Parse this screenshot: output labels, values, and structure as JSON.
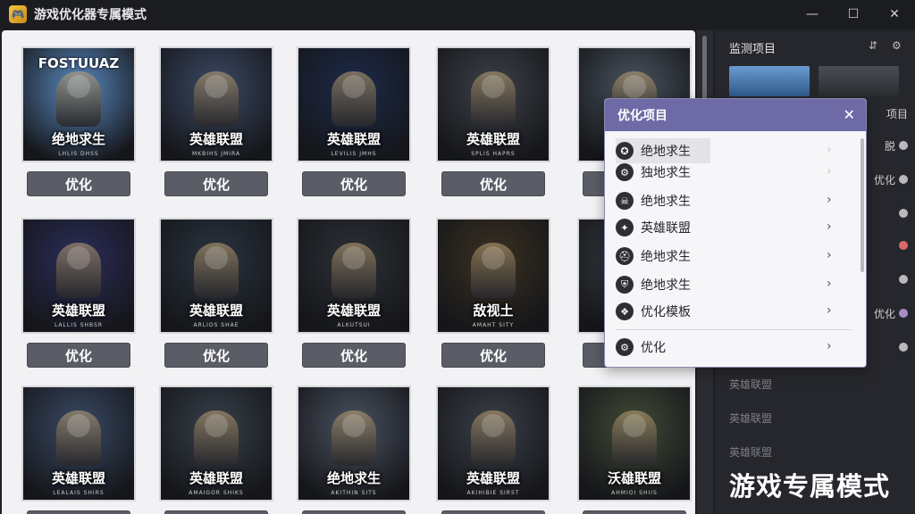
{
  "window": {
    "title": "游戏优化器专属模式",
    "app_icon": "game-controller-icon",
    "controls": {
      "minimize": "—",
      "maximize": "☐",
      "close": "✕"
    }
  },
  "grid": {
    "button_label": "优化",
    "rows": [
      [
        {
          "title": "绝地求生",
          "sub": "LHLIS DHSS",
          "brand": "FOSTUUAZ",
          "theme": "#5a8ac0"
        },
        {
          "title": "英雄联盟",
          "sub": "MKBIHS JMIRA",
          "theme": "#3b4a66"
        },
        {
          "title": "英雄联盟",
          "sub": "LEVILIS JMHS",
          "theme": "#1c2a4a"
        },
        {
          "title": "英雄联盟",
          "sub": "SPLIS HAPRS",
          "theme": "#3c4148"
        },
        {
          "title": "",
          "sub": "",
          "theme": "#4a5560"
        }
      ],
      [
        {
          "title": "英雄联盟",
          "sub": "LALLIS SHBSR",
          "theme": "#2b2d5a"
        },
        {
          "title": "英雄联盟",
          "sub": "ARLIOS SHAE",
          "theme": "#2a3440"
        },
        {
          "title": "英雄联盟",
          "sub": "ALKUTSUI",
          "theme": "#2c3036"
        },
        {
          "title": "敌视土",
          "sub": "AMAHT SITY",
          "theme": "#3a3020"
        },
        {
          "title": "",
          "sub": "",
          "theme": "#3a4048"
        }
      ],
      [
        {
          "title": "英雄联盟",
          "sub": "LEALAIS SHIRS",
          "theme": "#3a4a66"
        },
        {
          "title": "英雄联盟",
          "sub": "AMAIGOR SHIKS",
          "theme": "#36404a"
        },
        {
          "title": "绝地求生",
          "sub": "AKITHIN SITS",
          "theme": "#4a5260"
        },
        {
          "title": "英雄联盟",
          "sub": "AKIHIBIE SIRST",
          "theme": "#3a4048"
        },
        {
          "title": "沃雄联盟",
          "sub": "AHMIOI SHIIS",
          "theme": "#404a36"
        }
      ]
    ]
  },
  "right_panel": {
    "header": "监测项目",
    "header_icons": [
      "pin-icon",
      "settings-icon"
    ],
    "rows": [
      {
        "label": "项目",
        "dot": ""
      },
      {
        "label": "脱",
        "dot": "#b8b8be"
      },
      {
        "label": "优化",
        "dot": "#b8b8be"
      },
      {
        "label": "",
        "dot": "#b8b8be"
      },
      {
        "label": "",
        "dot": "#d96a6a"
      },
      {
        "label": "",
        "dot": "#b8b8be"
      },
      {
        "label": "优化",
        "dot": "#a98cc8"
      },
      {
        "label": "",
        "dot": "#b8b8be"
      }
    ],
    "list": [
      "英雄联盟",
      "英雄联盟",
      "英雄联盟"
    ],
    "mode_label": "游戏专属模式"
  },
  "popup": {
    "title": "优化项目",
    "close": "✕",
    "items": [
      {
        "label": "绝地求生",
        "icon": "pubg-icon",
        "active": true
      },
      {
        "label": "独地求生",
        "icon": "gear-badge-icon",
        "active": false
      },
      {
        "label": "绝地求生",
        "icon": "skull-icon",
        "active": false
      },
      {
        "label": "英雄联盟",
        "icon": "lol-icon",
        "active": false
      },
      {
        "label": "绝地求生",
        "icon": "helmet-icon",
        "active": false
      },
      {
        "label": "绝地求生",
        "icon": "shield-icon",
        "active": false
      },
      {
        "label": "优化模板",
        "icon": "template-icon",
        "active": false
      }
    ],
    "footer": {
      "label": "优化",
      "icon": "settings-icon"
    },
    "chevron": "›"
  }
}
